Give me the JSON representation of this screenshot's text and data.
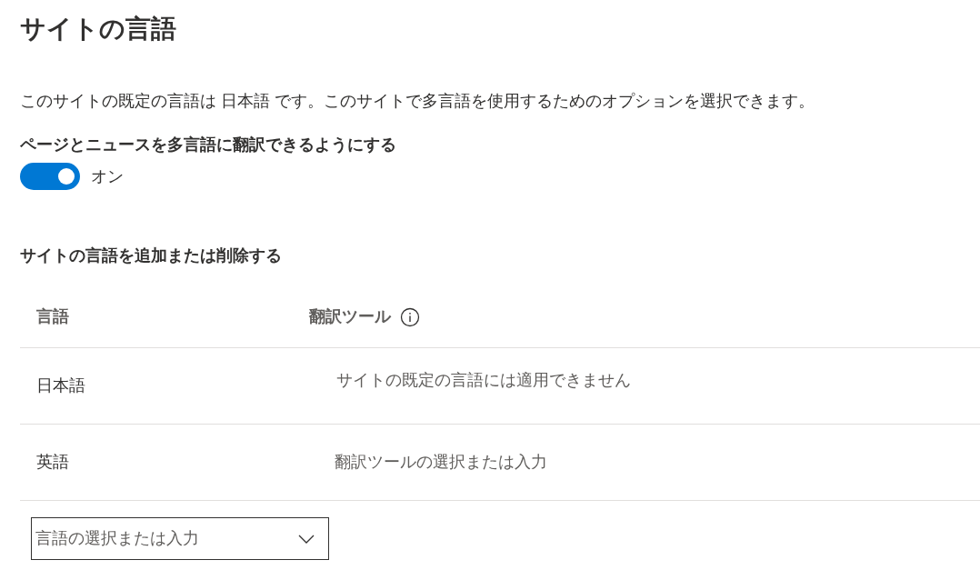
{
  "title": "サイトの言語",
  "description": "このサイトの既定の言語は 日本語 です。このサイトで多言語を使用するためのオプションを選択できます。",
  "translation_setting": {
    "label": "ページとニュースを多言語に翻訳できるようにする",
    "toggle": {
      "on": true,
      "label": "オン"
    }
  },
  "languages_section": {
    "heading": "サイトの言語を追加または削除する",
    "columns": [
      "言語",
      "翻訳ツール"
    ],
    "rows": [
      {
        "kind": "text",
        "language": "日本語",
        "translators": "サイトの既定の言語には適用できません"
      },
      {
        "kind": "field",
        "language": "英語",
        "translators_placeholder": "翻訳ツールの選択または入力"
      }
    ],
    "add_language": {
      "placeholder": "言語の選択または入力"
    }
  }
}
